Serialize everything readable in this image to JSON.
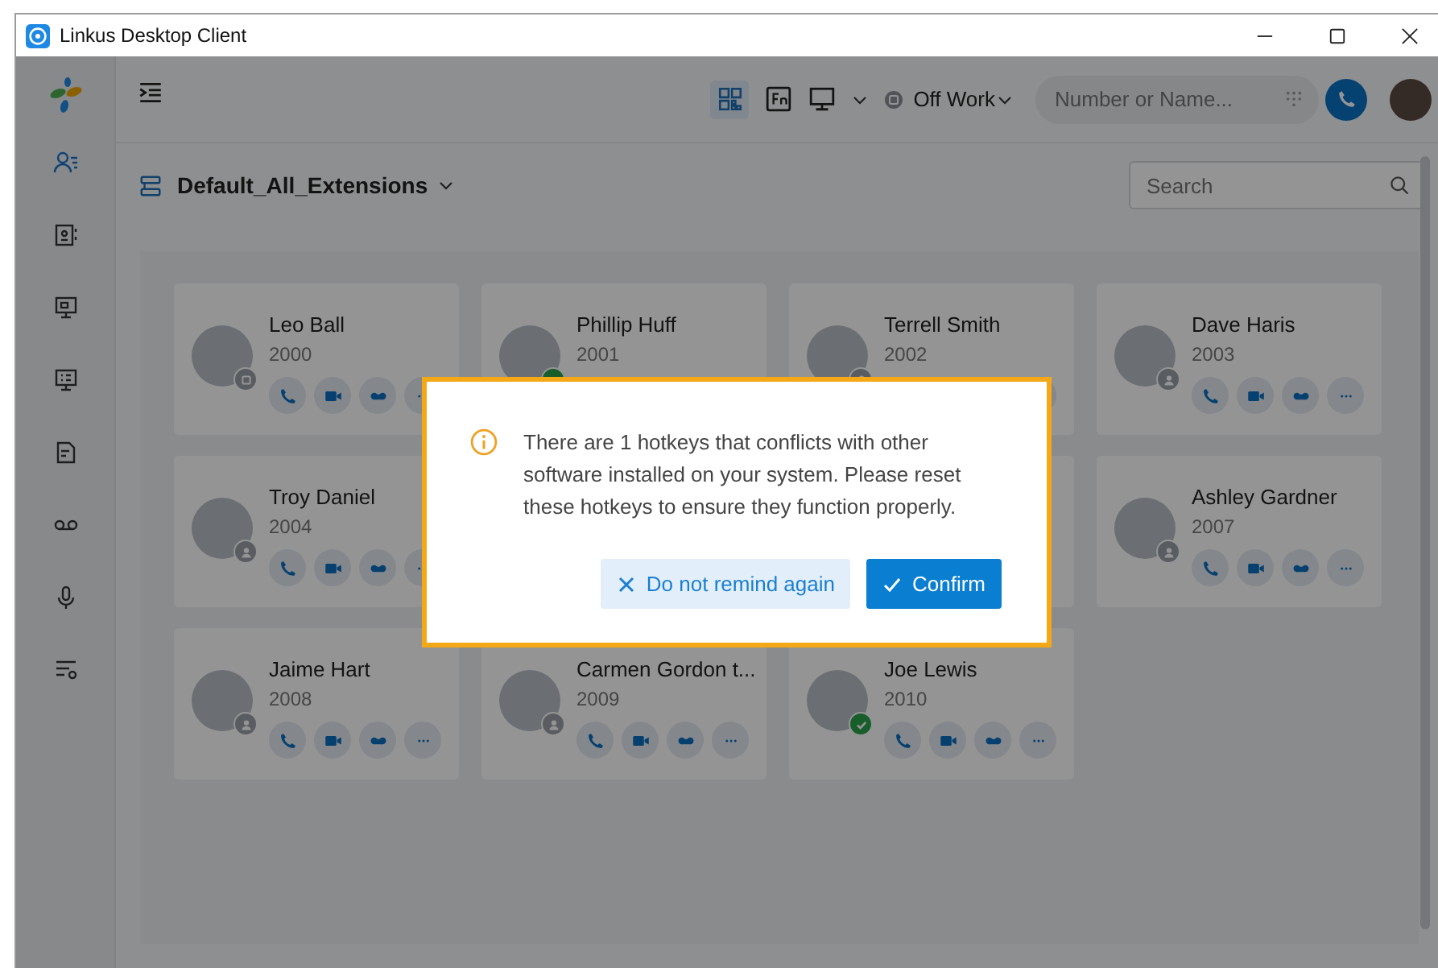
{
  "window": {
    "title": "Linkus Desktop Client"
  },
  "sidebar": {
    "items": [
      {
        "kind": "contacts",
        "selected": true
      },
      {
        "kind": "phonebook",
        "selected": false
      },
      {
        "kind": "conference",
        "selected": false
      },
      {
        "kind": "monitor",
        "selected": false
      },
      {
        "kind": "document",
        "selected": false
      },
      {
        "kind": "voicemail",
        "selected": false
      },
      {
        "kind": "microphone",
        "selected": false
      },
      {
        "kind": "settings",
        "selected": false
      }
    ]
  },
  "topbar": {
    "status": "Off Work",
    "dial": {
      "placeholder": "Number or Name..."
    }
  },
  "group": {
    "name": "Default_All_Extensions",
    "search": {
      "placeholder": "Search"
    }
  },
  "contacts": [
    {
      "name": "Leo Ball",
      "ext": "2000",
      "kind": "away"
    },
    {
      "name": "Phillip Huff",
      "ext": "2001",
      "kind": "available"
    },
    {
      "name": "Terrell Smith",
      "ext": "2002",
      "kind": "offline"
    },
    {
      "name": "Dave Haris",
      "ext": "2003",
      "kind": "offline"
    },
    {
      "name": "Troy Daniel",
      "ext": "2004",
      "kind": "offline"
    },
    {
      "name": "Ashley Gardner",
      "ext": "2007",
      "kind": "offline"
    },
    {
      "name": "Jaime Hart",
      "ext": "2008",
      "kind": "offline"
    },
    {
      "name": "Carmen Gordon t...",
      "ext": "2009",
      "kind": "offline"
    },
    {
      "name": "Joe Lewis",
      "ext": "2010",
      "kind": "available"
    }
  ],
  "dialog": {
    "message": "There are 1 hotkeys that conflicts with other software installed on your system. Please reset these hotkeys to ensure they function properly.",
    "buttons": [
      {
        "label": "Do not remind again",
        "kind": "secondary"
      },
      {
        "label": "Confirm",
        "kind": "primary"
      }
    ]
  }
}
